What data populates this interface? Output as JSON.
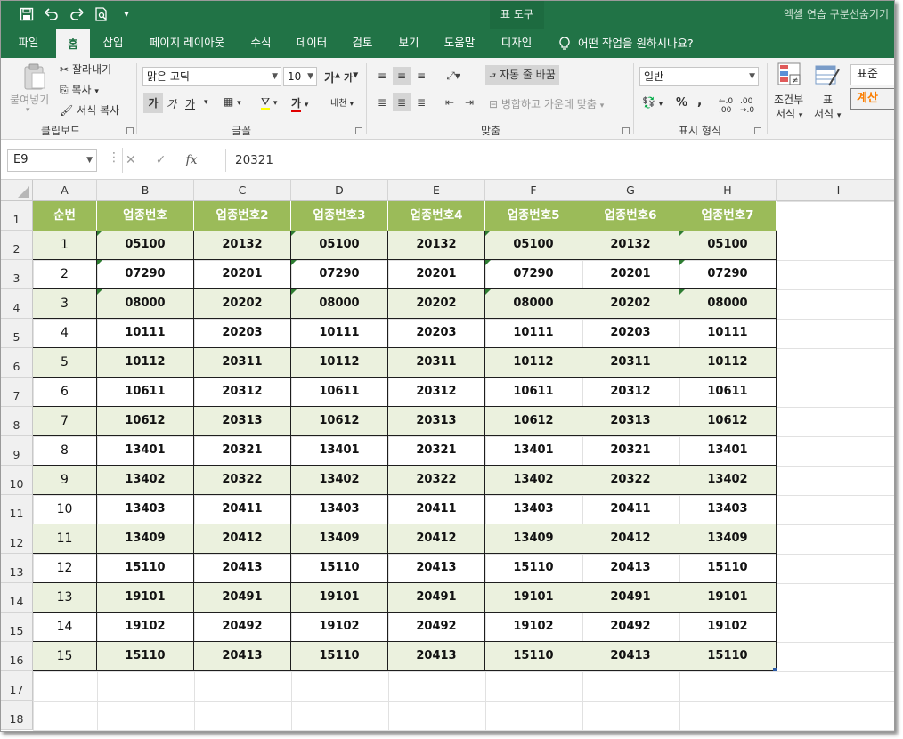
{
  "window_title": "엑셀 연습 구분선숨기기",
  "context_tool_label": "표 도구",
  "quick_access": [
    {
      "icon": "save-icon",
      "glyph": "🖫"
    },
    {
      "icon": "undo-icon",
      "glyph": "↶"
    },
    {
      "icon": "redo-icon",
      "glyph": "↷"
    },
    {
      "icon": "print-preview-icon",
      "glyph": "⎙"
    },
    {
      "icon": "customize-qat-icon",
      "glyph": "⌄"
    }
  ],
  "tabs": [
    "파일",
    "홈",
    "삽입",
    "페이지 레이아웃",
    "수식",
    "데이터",
    "검토",
    "보기",
    "도움말",
    "디자인"
  ],
  "active_tab": "홈",
  "tell_me": "어떤 작업을 원하시나요?",
  "ribbon": {
    "clipboard": {
      "paste": "붙여넣기",
      "cut": "잘라내기",
      "copy": "복사",
      "format_painter": "서식 복사",
      "label": "클립보드"
    },
    "font": {
      "font_name": "맑은 고딕",
      "font_size": "10",
      "grow": "가",
      "shrink": "가",
      "bold": "가",
      "italic": "가",
      "underline": "가",
      "font_color_glyph": "가",
      "phonetic": "내천",
      "label": "글꼴"
    },
    "alignment": {
      "wrap_text": "자동 줄 바꿈",
      "merge_center": "병합하고 가운데 맞춤",
      "label": "맞춤"
    },
    "number": {
      "format": "일반",
      "percent": "%",
      "comma": ",",
      "label": "표시 형식"
    },
    "styles": {
      "conditional": "조건부",
      "conditional2": "서식",
      "table": "표",
      "table2": "서식",
      "style_normal": "표준",
      "style_calc": "계산"
    }
  },
  "formula_bar": {
    "name_box": "E9",
    "cancel": "✕",
    "enter": "✓",
    "fx": "fx",
    "value": "20321"
  },
  "columns": [
    "A",
    "B",
    "C",
    "D",
    "E",
    "F",
    "G",
    "H",
    "I"
  ],
  "row_numbers": [
    "1",
    "2",
    "3",
    "4",
    "5",
    "6",
    "7",
    "8",
    "9",
    "10",
    "11",
    "12",
    "13",
    "14",
    "15",
    "16",
    "17",
    "18"
  ],
  "table": {
    "headers": [
      "순번",
      "업종번호",
      "업종번호2",
      "업종번호3",
      "업종번호4",
      "업종번호5",
      "업종번호6",
      "업종번호7"
    ],
    "rows": [
      [
        "1",
        "05100",
        "20132",
        "05100",
        "20132",
        "05100",
        "20132",
        "05100"
      ],
      [
        "2",
        "07290",
        "20201",
        "07290",
        "20201",
        "07290",
        "20201",
        "07290"
      ],
      [
        "3",
        "08000",
        "20202",
        "08000",
        "20202",
        "08000",
        "20202",
        "08000"
      ],
      [
        "4",
        "10111",
        "20203",
        "10111",
        "20203",
        "10111",
        "20203",
        "10111"
      ],
      [
        "5",
        "10112",
        "20311",
        "10112",
        "20311",
        "10112",
        "20311",
        "10112"
      ],
      [
        "6",
        "10611",
        "20312",
        "10611",
        "20312",
        "10611",
        "20312",
        "10611"
      ],
      [
        "7",
        "10612",
        "20313",
        "10612",
        "20313",
        "10612",
        "20313",
        "10612"
      ],
      [
        "8",
        "13401",
        "20321",
        "13401",
        "20321",
        "13401",
        "20321",
        "13401"
      ],
      [
        "9",
        "13402",
        "20322",
        "13402",
        "20322",
        "13402",
        "20322",
        "13402"
      ],
      [
        "10",
        "13403",
        "20411",
        "13403",
        "20411",
        "13403",
        "20411",
        "13403"
      ],
      [
        "11",
        "13409",
        "20412",
        "13409",
        "20412",
        "13409",
        "20412",
        "13409"
      ],
      [
        "12",
        "15110",
        "20413",
        "15110",
        "20413",
        "15110",
        "20413",
        "15110"
      ],
      [
        "13",
        "19101",
        "20491",
        "19101",
        "20491",
        "19101",
        "20491",
        "19101"
      ],
      [
        "14",
        "19102",
        "20492",
        "19102",
        "20492",
        "19102",
        "20492",
        "19102"
      ],
      [
        "15",
        "15110",
        "20413",
        "15110",
        "20413",
        "15110",
        "20413",
        "15110"
      ]
    ],
    "text_flag_rows": [
      1,
      2,
      3
    ],
    "text_flag_cols": [
      1,
      3,
      5,
      7
    ]
  },
  "colors": {
    "accent": "#217346",
    "header_fill": "#9bbb59",
    "band_fill": "#ebf1de",
    "text_flag": "#2e7d32",
    "calc_style": "#fa7d00"
  }
}
